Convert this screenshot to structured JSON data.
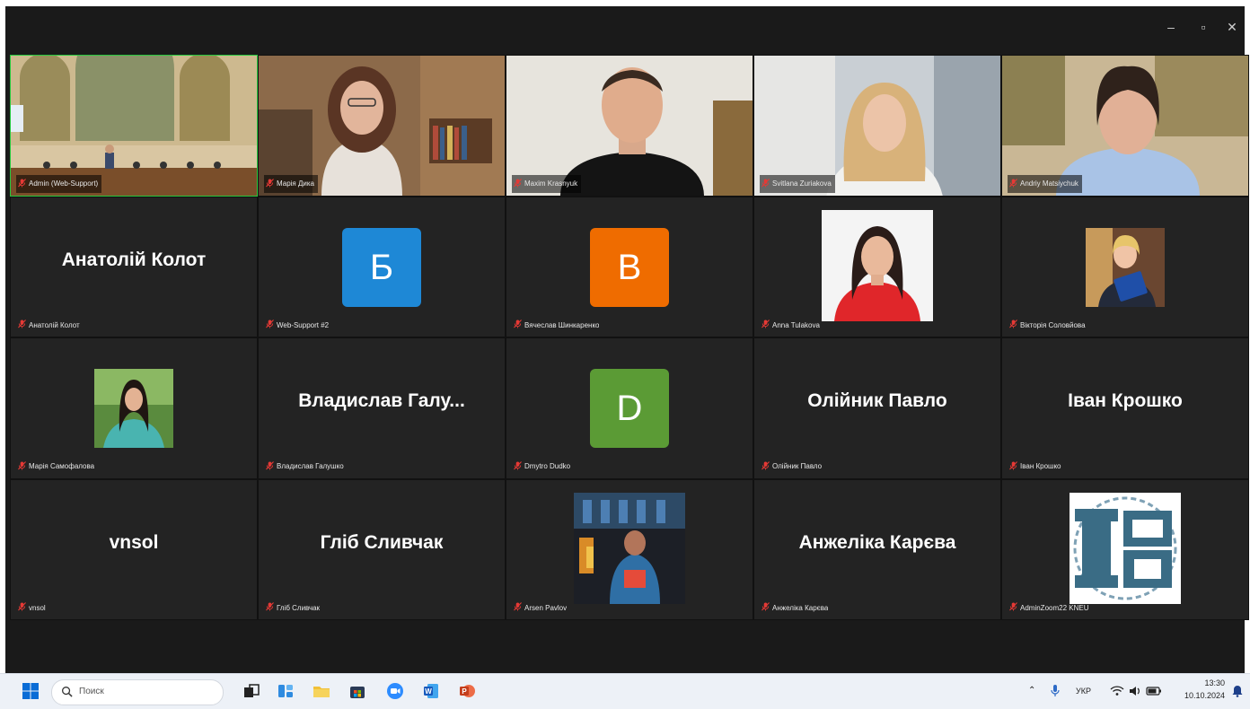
{
  "window": {
    "minimize_glyph": "–",
    "restore_glyph": "▫",
    "close_glyph": "✕"
  },
  "participants": [
    {
      "tile_name": "Admin (Web-Support)",
      "type": "video",
      "scene": "room",
      "active": true
    },
    {
      "tile_name": "Марія Дика",
      "type": "video",
      "scene": "woman-shelves"
    },
    {
      "tile_name": "Maxim Krasnyuk",
      "type": "video",
      "scene": "man-plain"
    },
    {
      "tile_name": "Svitlana Zuriakova",
      "type": "video",
      "scene": "woman-blonde"
    },
    {
      "tile_name": "Andriy Matsiychuk",
      "type": "video",
      "scene": "man-paintings"
    },
    {
      "tile_name": "Анатолій Колот",
      "type": "name",
      "display": "Анатолій Колот"
    },
    {
      "tile_name": "Web-Support #2",
      "type": "letter",
      "letter": "Б",
      "color": "#1e88d6"
    },
    {
      "tile_name": "Вячеслав Шинкаренко",
      "type": "letter",
      "letter": "В",
      "color": "#ef6c00"
    },
    {
      "tile_name": "Anna Tulakova",
      "type": "photo",
      "scene": "woman-red"
    },
    {
      "tile_name": "Вікторія Соловйова",
      "type": "photo",
      "scene": "woman-folder"
    },
    {
      "tile_name": "Марія Самофалова",
      "type": "photo",
      "scene": "woman-green"
    },
    {
      "tile_name": "Владислав Галушко",
      "type": "name",
      "display": "Владислав  Галу..."
    },
    {
      "tile_name": "Dmytro Dudko",
      "type": "letter",
      "letter": "D",
      "color": "#5b9b35"
    },
    {
      "tile_name": "Олійник Павло",
      "type": "name",
      "display": "Олійник Павло"
    },
    {
      "tile_name": "Іван Крошко",
      "type": "name",
      "display": "Іван Крошко"
    },
    {
      "tile_name": "vnsol",
      "type": "name",
      "display": "vnsol"
    },
    {
      "tile_name": "Гліб Сливчак",
      "type": "name",
      "display": "Гліб Сливчак"
    },
    {
      "tile_name": "Arsen Pavlov",
      "type": "photo",
      "scene": "bar"
    },
    {
      "tile_name": "Анжеліка Карєва",
      "type": "name",
      "display": "Анжеліка Карєва"
    },
    {
      "tile_name": "AdminZoom22 KNEU",
      "type": "photo",
      "scene": "logo"
    }
  ],
  "taskbar": {
    "search_placeholder": "Поиск",
    "language": "УКР",
    "time": "13:30",
    "date": "10.10.2024",
    "apps": [
      "start-icon",
      "task-view-icon",
      "widgets-icon",
      "file-explorer-icon",
      "store-icon",
      "zoom-icon",
      "word-icon",
      "powerpoint-icon"
    ]
  },
  "colors": {
    "zoom_bg": "#1a1a1a",
    "tile_bg": "#232323",
    "active_border": "#27c93f",
    "mic_muted": "#e53935",
    "taskbar_bg": "#edf1f7"
  }
}
